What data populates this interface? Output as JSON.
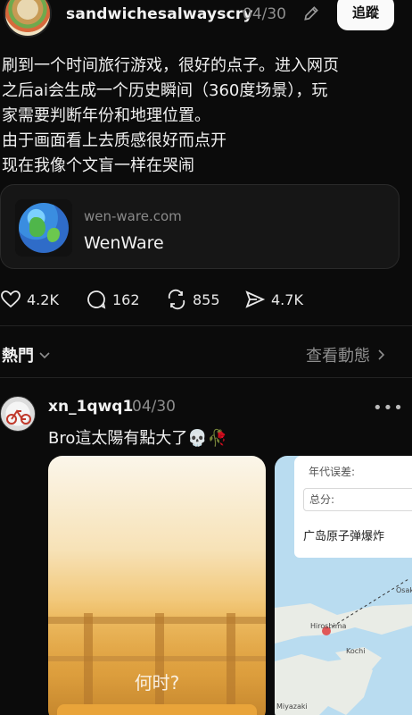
{
  "post": {
    "username": "sandwichesalwayscry",
    "date": "04/30",
    "follow_label": "追蹤",
    "text_lines": [
      "刷到一个时间旅行游戏，很好的点子。进入网页",
      "之后ai会生成一个历史瞬间（360度场景），玩",
      "家需要判断年份和地理位置。",
      "由于画面看上去质感很好而点开",
      "现在我像个文盲一样在哭闹"
    ],
    "link_card": {
      "domain": "wen-ware.com",
      "title": "WenWare"
    },
    "actions": {
      "likes": "4.2K",
      "comments": "162",
      "reposts": "855",
      "shares": "4.7K"
    }
  },
  "replies_header": {
    "sort_label": "熱門",
    "view_activity_label": "查看動態"
  },
  "reply": {
    "username": "xn_1qwq1",
    "date": "04/30",
    "text": "Bro這太陽有點大了💀🥀",
    "image1": {
      "overlay_text": "何时?"
    },
    "image2": {
      "field_year_error": "年代误差:",
      "field_score": "总分:",
      "answer": "广岛原子弹爆炸",
      "map_labels": [
        "Hiroshima",
        "Kochi",
        "Osak",
        "Miyazaki"
      ]
    }
  },
  "colors": {
    "background": "#0b0b0b",
    "secondary_text": "#8e8e8e",
    "follow_button": "#fafafa"
  }
}
